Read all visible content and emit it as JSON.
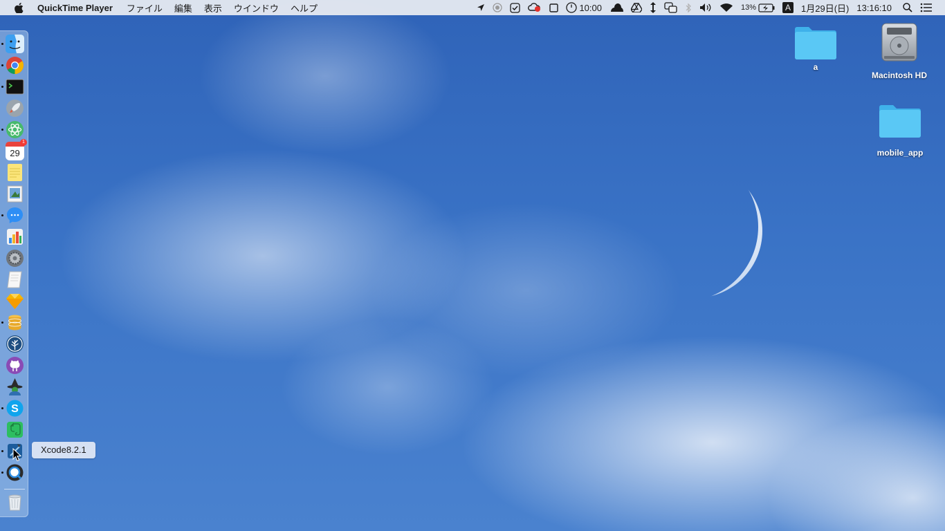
{
  "menubar": {
    "app_name": "QuickTime Player",
    "menus": [
      "ファイル",
      "編集",
      "表示",
      "ウインドウ",
      "ヘルプ"
    ],
    "status": {
      "timer_text": "10:00",
      "battery_percent": "13%",
      "input_source": "A",
      "date": "1月29日(日)",
      "time": "13:16:10"
    }
  },
  "dock": {
    "items": [
      {
        "name": "Finder",
        "icon": "finder-icon",
        "running": true
      },
      {
        "name": "Google Chrome",
        "icon": "chrome-icon",
        "running": true
      },
      {
        "name": "Terminal",
        "icon": "terminal-icon",
        "running": true
      },
      {
        "name": "Launchpad",
        "icon": "rocket-icon",
        "running": false
      },
      {
        "name": "Atom",
        "icon": "atom-icon",
        "running": true
      },
      {
        "name": "Calendar",
        "icon": "calendar-icon",
        "running": false,
        "label": "29",
        "badge": "1"
      },
      {
        "name": "Notes",
        "icon": "notes-icon",
        "running": false
      },
      {
        "name": "Preview",
        "icon": "preview-icon",
        "running": false
      },
      {
        "name": "Messenger",
        "icon": "messenger-icon",
        "running": true
      },
      {
        "name": "Numbers",
        "icon": "chart-icon",
        "running": false
      },
      {
        "name": "System Preferences",
        "icon": "gear-icon",
        "running": false
      },
      {
        "name": "TextEdit",
        "icon": "textedit-icon",
        "running": false
      },
      {
        "name": "Sketch",
        "icon": "sketch-icon",
        "running": false
      },
      {
        "name": "Sequel Pro",
        "icon": "database-icon",
        "running": true
      },
      {
        "name": "SourceTree",
        "icon": "sourcetree-icon",
        "running": false
      },
      {
        "name": "GitHub Desktop",
        "icon": "github-icon",
        "running": false
      },
      {
        "name": "Alfred",
        "icon": "wizard-icon",
        "running": false
      },
      {
        "name": "Skype",
        "icon": "skype-icon",
        "running": true
      },
      {
        "name": "Evernote",
        "icon": "evernote-icon",
        "running": false
      },
      {
        "name": "Xcode",
        "icon": "xcode-icon",
        "running": true
      },
      {
        "name": "QuickTime Player",
        "icon": "quicktime-icon",
        "running": true
      }
    ],
    "trash": {
      "icon": "trash-icon"
    },
    "tooltip": "Xcode8.2.1"
  },
  "desktop": {
    "icons": [
      {
        "label": "a",
        "icon": "folder-icon"
      },
      {
        "label": "Macintosh HD",
        "icon": "hard-drive-icon"
      },
      {
        "label": "mobile_app",
        "icon": "folder-icon"
      }
    ]
  },
  "colors": {
    "menubar_bg": "#eceef2",
    "wallpaper_top": "#2f63b8",
    "wallpaper_bottom": "#4a82cf",
    "folder": "#5ac8f5"
  }
}
